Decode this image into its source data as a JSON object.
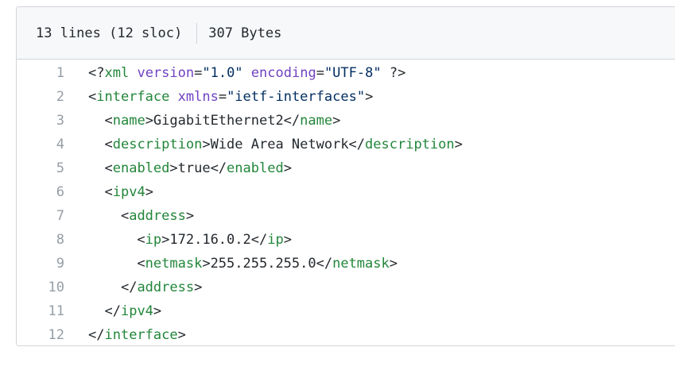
{
  "file_info": {
    "lines": "13 lines (12 sloc)",
    "size": "307 Bytes"
  },
  "code_lines": [
    {
      "num": "1",
      "indent": "",
      "tokens": [
        {
          "t": "plain",
          "v": "<?"
        },
        {
          "t": "tag",
          "v": "xml"
        },
        {
          "t": "plain",
          "v": " "
        },
        {
          "t": "attr",
          "v": "version"
        },
        {
          "t": "plain",
          "v": "="
        },
        {
          "t": "str",
          "v": "\"1.0\""
        },
        {
          "t": "plain",
          "v": " "
        },
        {
          "t": "attr",
          "v": "encoding"
        },
        {
          "t": "plain",
          "v": "="
        },
        {
          "t": "str",
          "v": "\"UTF-8\""
        },
        {
          "t": "plain",
          "v": " ?>"
        }
      ]
    },
    {
      "num": "2",
      "indent": "",
      "tokens": [
        {
          "t": "plain",
          "v": "<"
        },
        {
          "t": "tag",
          "v": "interface"
        },
        {
          "t": "plain",
          "v": " "
        },
        {
          "t": "attr",
          "v": "xmlns"
        },
        {
          "t": "plain",
          "v": "="
        },
        {
          "t": "str",
          "v": "\"ietf-interfaces\""
        },
        {
          "t": "plain",
          "v": ">"
        }
      ]
    },
    {
      "num": "3",
      "indent": "  ",
      "tokens": [
        {
          "t": "plain",
          "v": "<"
        },
        {
          "t": "tag",
          "v": "name"
        },
        {
          "t": "plain",
          "v": ">GigabitEthernet2</"
        },
        {
          "t": "tag",
          "v": "name"
        },
        {
          "t": "plain",
          "v": ">"
        }
      ]
    },
    {
      "num": "4",
      "indent": "  ",
      "tokens": [
        {
          "t": "plain",
          "v": "<"
        },
        {
          "t": "tag",
          "v": "description"
        },
        {
          "t": "plain",
          "v": ">Wide Area Network</"
        },
        {
          "t": "tag",
          "v": "description"
        },
        {
          "t": "plain",
          "v": ">"
        }
      ]
    },
    {
      "num": "5",
      "indent": "  ",
      "tokens": [
        {
          "t": "plain",
          "v": "<"
        },
        {
          "t": "tag",
          "v": "enabled"
        },
        {
          "t": "plain",
          "v": ">true</"
        },
        {
          "t": "tag",
          "v": "enabled"
        },
        {
          "t": "plain",
          "v": ">"
        }
      ]
    },
    {
      "num": "6",
      "indent": "  ",
      "tokens": [
        {
          "t": "plain",
          "v": "<"
        },
        {
          "t": "tag",
          "v": "ipv4"
        },
        {
          "t": "plain",
          "v": ">"
        }
      ]
    },
    {
      "num": "7",
      "indent": "    ",
      "tokens": [
        {
          "t": "plain",
          "v": "<"
        },
        {
          "t": "tag",
          "v": "address"
        },
        {
          "t": "plain",
          "v": ">"
        }
      ]
    },
    {
      "num": "8",
      "indent": "      ",
      "tokens": [
        {
          "t": "plain",
          "v": "<"
        },
        {
          "t": "tag",
          "v": "ip"
        },
        {
          "t": "plain",
          "v": ">172.16.0.2</"
        },
        {
          "t": "tag",
          "v": "ip"
        },
        {
          "t": "plain",
          "v": ">"
        }
      ]
    },
    {
      "num": "9",
      "indent": "      ",
      "tokens": [
        {
          "t": "plain",
          "v": "<"
        },
        {
          "t": "tag",
          "v": "netmask"
        },
        {
          "t": "plain",
          "v": ">255.255.255.0</"
        },
        {
          "t": "tag",
          "v": "netmask"
        },
        {
          "t": "plain",
          "v": ">"
        }
      ]
    },
    {
      "num": "10",
      "indent": "    ",
      "tokens": [
        {
          "t": "plain",
          "v": "</"
        },
        {
          "t": "tag",
          "v": "address"
        },
        {
          "t": "plain",
          "v": ">"
        }
      ]
    },
    {
      "num": "11",
      "indent": "  ",
      "tokens": [
        {
          "t": "plain",
          "v": "</"
        },
        {
          "t": "tag",
          "v": "ipv4"
        },
        {
          "t": "plain",
          "v": ">"
        }
      ]
    },
    {
      "num": "12",
      "indent": "",
      "tokens": [
        {
          "t": "plain",
          "v": "</"
        },
        {
          "t": "tag",
          "v": "interface"
        },
        {
          "t": "plain",
          "v": ">"
        }
      ]
    }
  ],
  "colors": {
    "tag": "#22863a",
    "attr": "#6f42c1",
    "string": "#032f62",
    "text": "#24292e",
    "line_number": "#959da5",
    "header_bg": "#f6f8fa",
    "border": "#d1d5da"
  }
}
